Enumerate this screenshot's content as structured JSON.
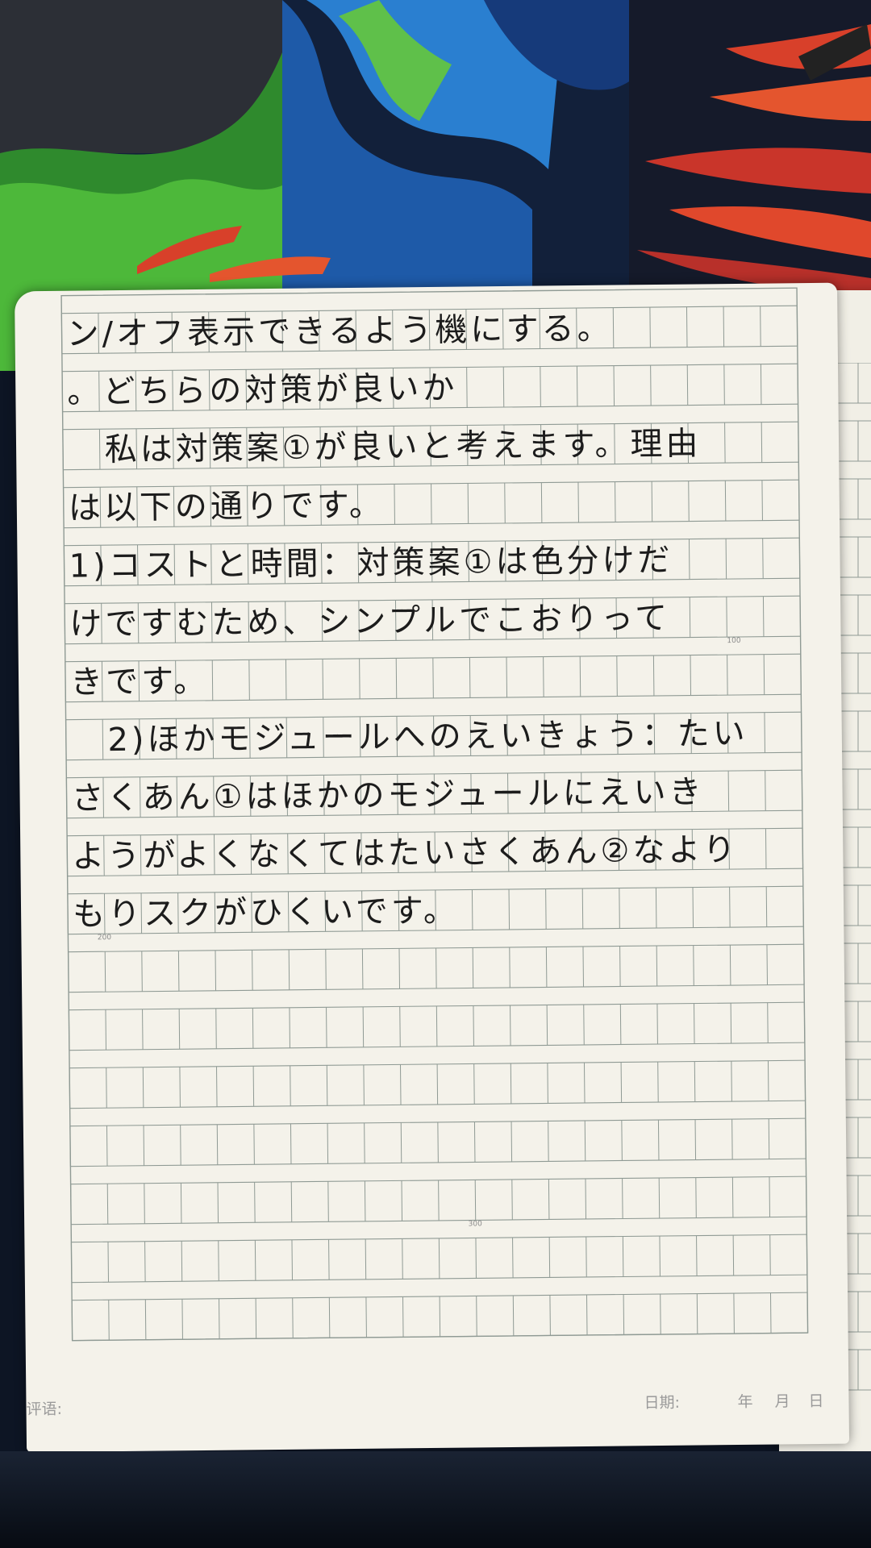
{
  "handwritten_lines": [
    "ン/オフ表示できるよう機にする。",
    "。どちらの対策が良いか",
    "私は対策案①が良いと考えます。理由",
    "は以下の通りです。",
    "1)コストと時間：対策案①は色分けだ",
    "けですむため、シンプルでこおりって",
    "きです。",
    "2)ほかモジュールへのえいきょう：たい",
    "さくあん①はほかのモジュールにえいき",
    "ようがよくなくてはたいさくあん②なより",
    "もりスクがひくいです。"
  ],
  "grid_counters": [
    "100",
    "200",
    "300"
  ],
  "footer": {
    "comment_label": "评语:",
    "date_label": "日期:",
    "year_label": "年",
    "month_label": "月",
    "day_label": "日"
  },
  "colors": {
    "paper": "#f4f2ea",
    "grid_line": "#8f9a94",
    "ink": "#1c1c1c",
    "fabric_green": "#3fa43a",
    "fabric_blue": "#1e5aa8",
    "fabric_red": "#d8402a"
  }
}
